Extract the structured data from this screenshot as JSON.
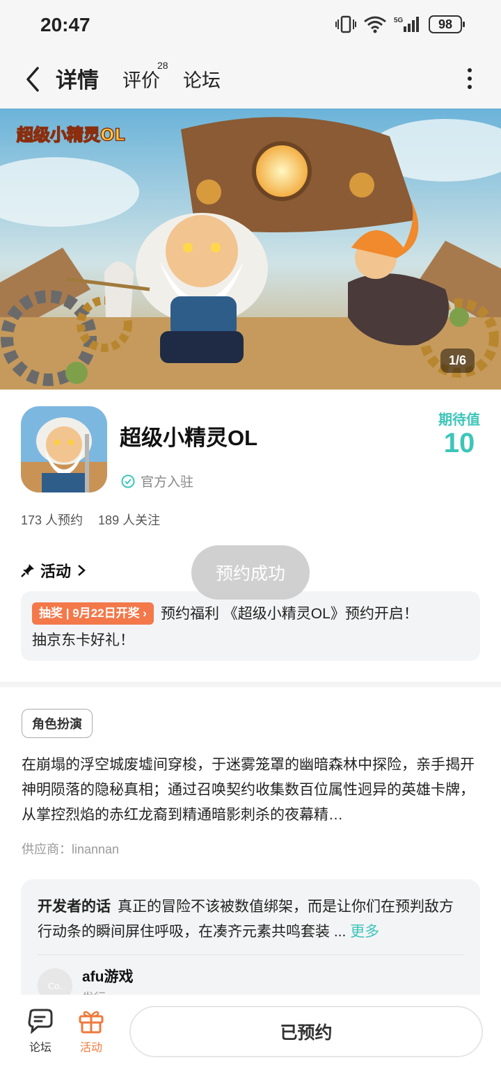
{
  "status_bar": {
    "time": "20:47",
    "battery": "98",
    "network": "5G"
  },
  "nav": {
    "tabs": [
      {
        "label": "详情",
        "active": true
      },
      {
        "label": "评价",
        "badge": "28"
      },
      {
        "label": "论坛"
      }
    ],
    "back_icon": "chevron-left-icon",
    "more_icon": "more-vertical-icon"
  },
  "banner": {
    "logo_text": "超级小精灵OL",
    "page_indicator": "1/6"
  },
  "game": {
    "name": "超级小精灵OL",
    "official_label": "官方入驻",
    "expect_label": "期待值",
    "expect_value": "10",
    "reservations": "173 人预约",
    "followers": "189 人关注"
  },
  "activity": {
    "header": "活动",
    "tag": "抽奖 | 9月22日开奖",
    "text_line1": "预约福利 《超级小精灵OL》预约开启！",
    "text_line2": "抽京东卡好礼！"
  },
  "toast": "预约成功",
  "details": {
    "genre": "角色扮演",
    "description": "在崩塌的浮空城废墟间穿梭，于迷雾笼罩的幽暗森林中探险，亲手揭开神明陨落的隐秘真相；通过召唤契约收集数百位属性迥异的英雄卡牌，从掌控烈焰的赤红龙裔到精通暗影刺杀的夜幕精…",
    "supplier": "供应商：linannan"
  },
  "developer": {
    "title": "开发者的话",
    "text": "真正的冒险不该被数值绑架，而是让你们在预判敌方行动条的瞬间屏住呼吸，在凑齐元素共鸣套装 ...",
    "more": "更多",
    "avatar_text": "Co.",
    "name": "afu游戏",
    "role": "发行"
  },
  "bottom": {
    "forum_label": "论坛",
    "activity_label": "活动",
    "button_label": "已预约"
  },
  "colors": {
    "accent": "#3dc5b9",
    "orange": "#f3784a"
  }
}
